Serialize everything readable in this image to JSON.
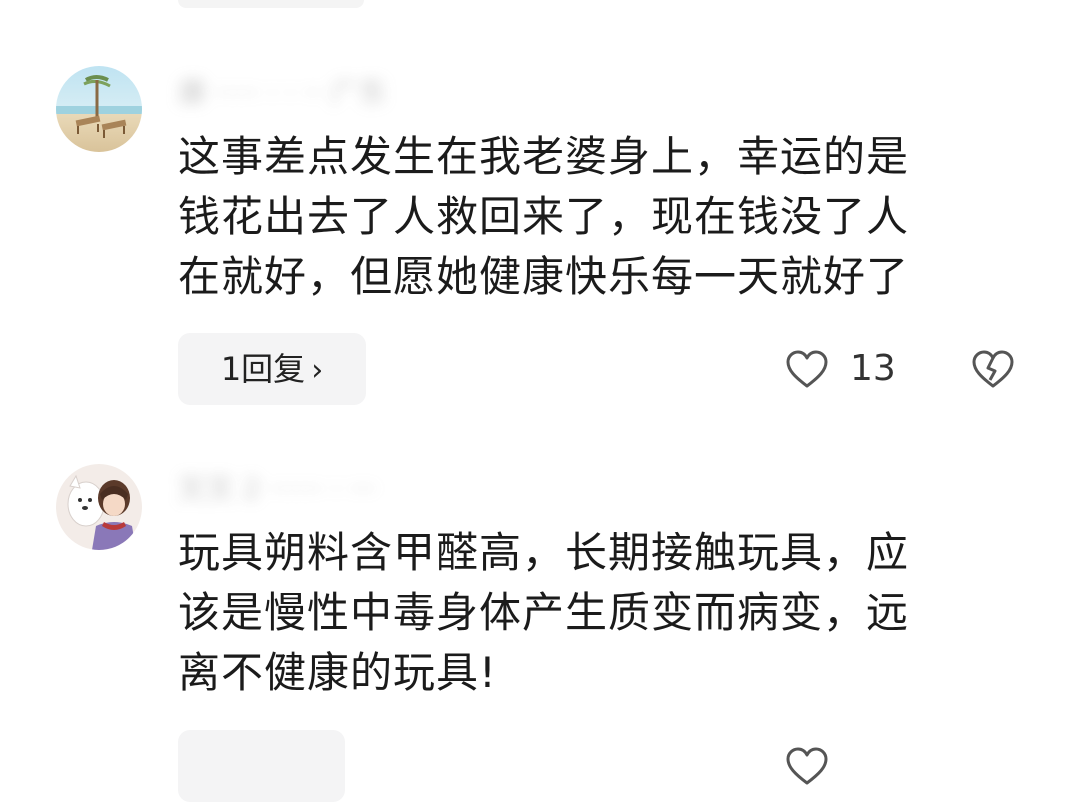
{
  "comments": [
    {
      "username": "康 ····· · · ·· 广东",
      "text_lines": [
        "这事差点发生在我老婆身上，幸运的是",
        "钱花出去了人救回来了，现在钱没了人",
        "在就好，但愿她健康快乐每一天就好了"
      ],
      "reply_label": "1回复",
      "reply_chevron": "›",
      "like_count": "13",
      "avatar": "beach-chairs-avatar",
      "like_icon": "heart-outline-icon",
      "dislike_icon": "broken-heart-icon"
    },
    {
      "username": "叉叉 2 ······ · ···",
      "text_lines": [
        "玩具朔料含甲醛高，长期接触玩具，应",
        "该是慢性中毒身体产生质变而病变，远",
        "离不健康的玩具!"
      ],
      "reply_label": "",
      "like_count": "",
      "avatar": "anime-person-dog-avatar",
      "like_icon": "heart-outline-icon"
    }
  ],
  "colors": {
    "background": "#ffffff",
    "text": "#1b1b1b",
    "pill": "#f4f4f5",
    "icon": "#555555"
  }
}
